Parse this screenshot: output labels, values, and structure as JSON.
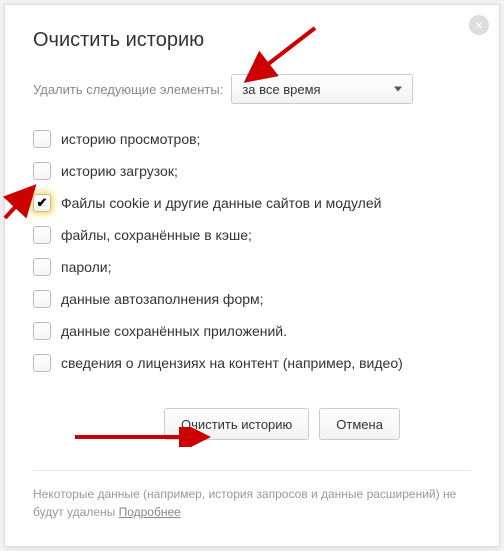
{
  "dialog": {
    "title": "Очистить историю",
    "promptLabel": "Удалить следующие элементы:",
    "timeRange": {
      "selected": "за все время"
    },
    "options": [
      {
        "label": "историю просмотров;",
        "checked": false
      },
      {
        "label": "историю загрузок;",
        "checked": false
      },
      {
        "label": "Файлы cookie и другие данные сайтов и модулей",
        "checked": true
      },
      {
        "label": "файлы, сохранённые в кэше;",
        "checked": false
      },
      {
        "label": "пароли;",
        "checked": false
      },
      {
        "label": "данные автозаполнения форм;",
        "checked": false
      },
      {
        "label": "данные сохранённых приложений.",
        "checked": false
      },
      {
        "label": "сведения о лицензиях на контент (например, видео)",
        "checked": false
      }
    ],
    "buttons": {
      "clear": "Очистить историю",
      "cancel": "Отмена"
    },
    "footer": {
      "text": "Некоторые данные (например, история запросов и данные расширений) не будут удалены ",
      "link": "Подробнее"
    }
  }
}
